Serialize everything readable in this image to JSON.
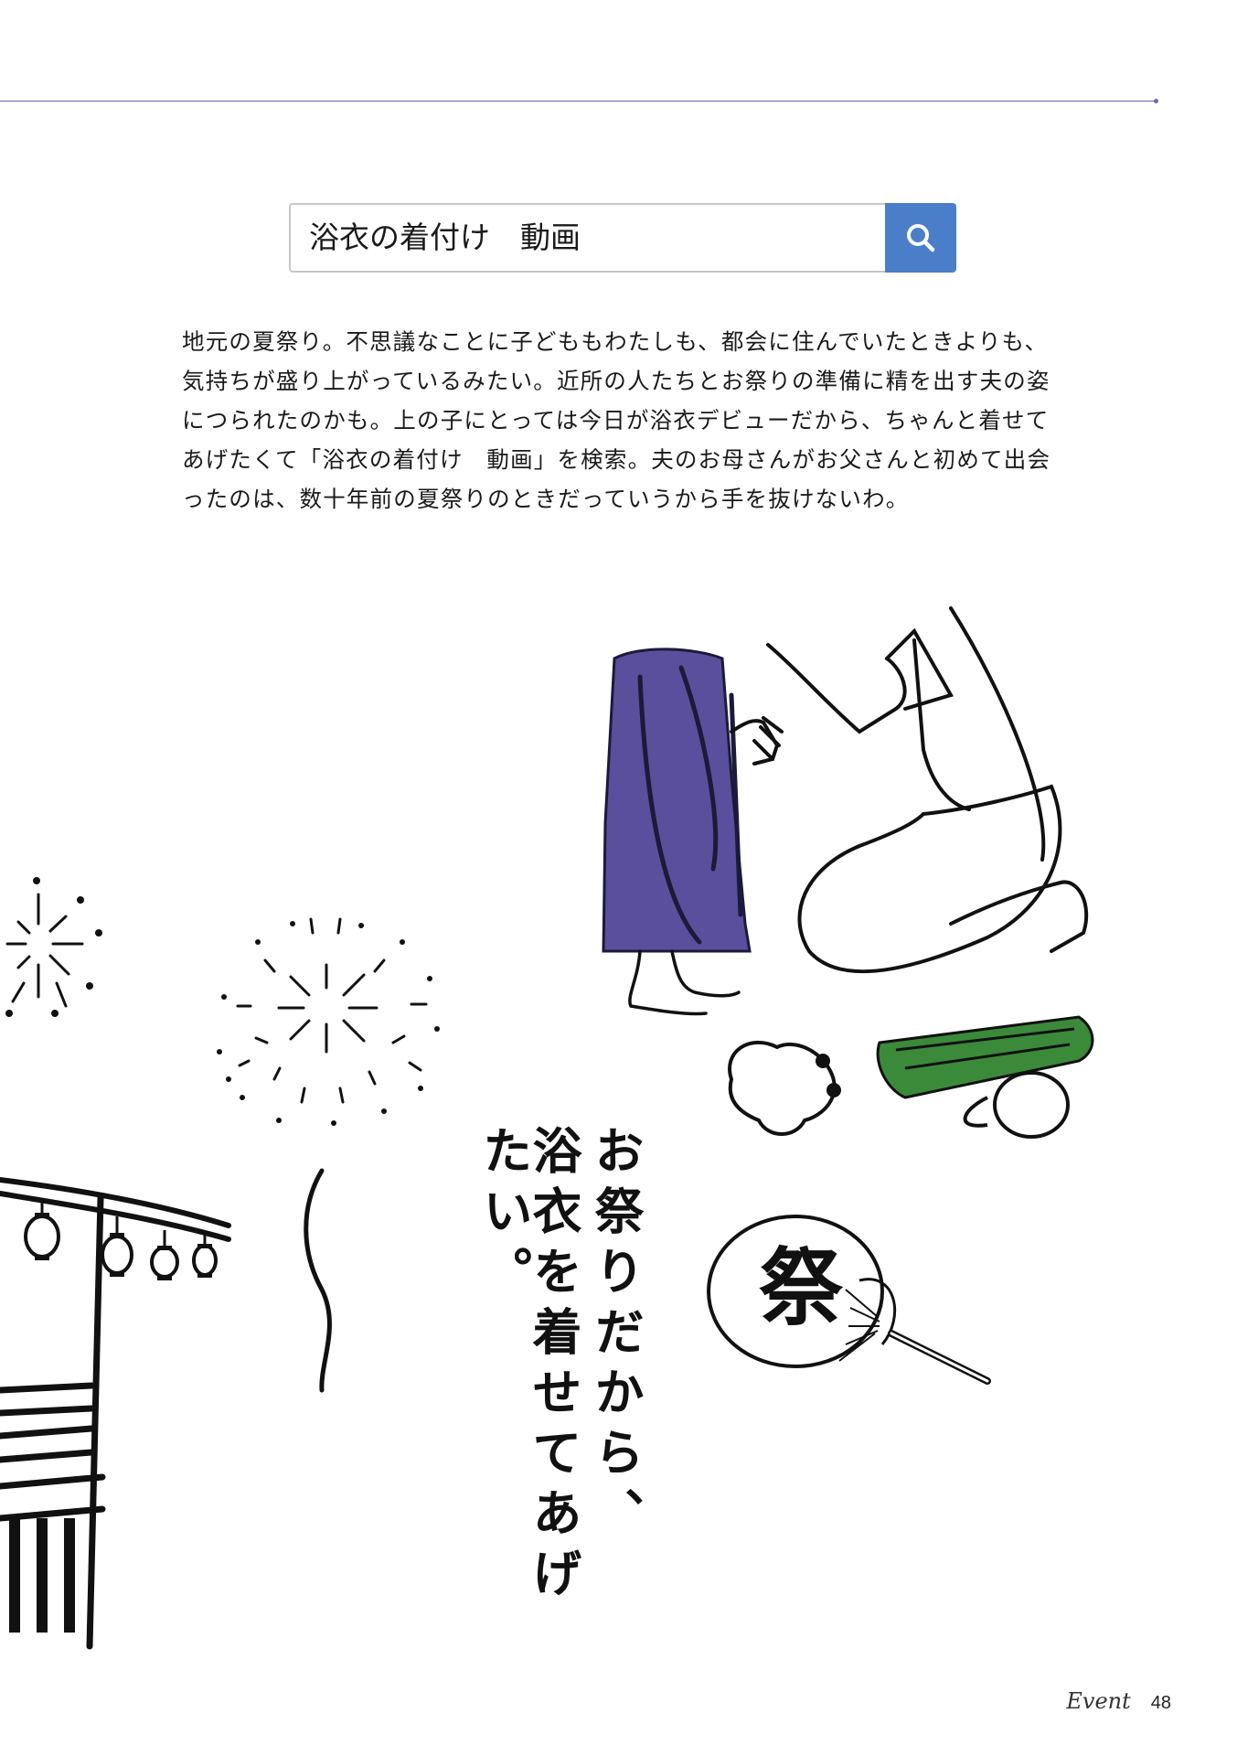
{
  "search": {
    "query": "浴衣の着付け　動画",
    "button_icon": "search-icon",
    "button_color": "#4a7ec8"
  },
  "body_text": "地元の夏祭り。不思議なことに子どももわたしも、都会に住んでいたときよりも、気持ちが盛り上がっているみたい。近所の人たちとお祭りの準備に精を出す夫の姿につられたのかも。上の子にとっては今日が浴衣デビューだから、ちゃんと着せてあげたくて「浴衣の着付け　動画」を検索。夫のお母さんがお父さんと初めて出会ったのは、数十年前の夏祭りのときだっていうから手を抜けないわ。",
  "caption": {
    "line1": "お祭りだから、",
    "line2": "浴衣を着せてあげたい。"
  },
  "fan_character": "祭",
  "footer": {
    "section": "Event",
    "page_number": "48"
  },
  "colors": {
    "rule": "#6b67b9",
    "yukata": "#5a4f9c",
    "obi": "#3a8a3a"
  }
}
